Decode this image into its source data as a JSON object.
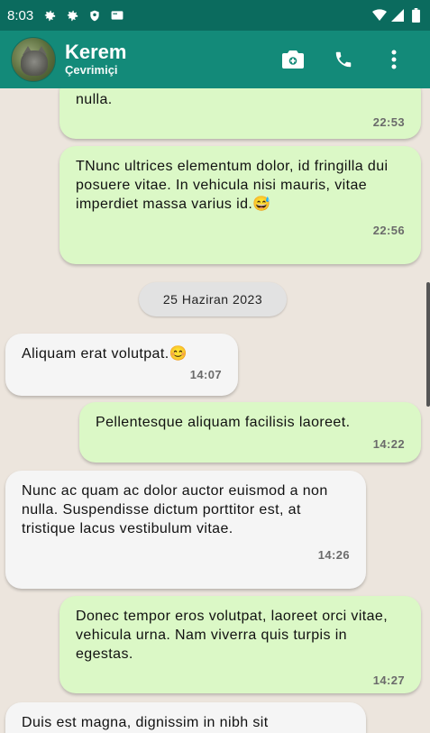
{
  "status_bar": {
    "time": "8:03",
    "left_icons": [
      "gear-icon",
      "gear-icon",
      "shield-icon",
      "card-icon"
    ],
    "right_icons": [
      "wifi-icon",
      "signal-icon",
      "battery-icon"
    ]
  },
  "header": {
    "name": "Kerem",
    "status": "Çevrimiçi",
    "actions": [
      "camera-icon",
      "phone-icon",
      "more-vert-icon"
    ]
  },
  "messages": [
    {
      "direction": "out",
      "text": "nulla.",
      "time": "22:53"
    },
    {
      "direction": "out",
      "text": "TNunc ultrices elementum dolor, id fringilla dui posuere vitae. In vehicula nisi mauris, vitae imperdiet massa varius id.😅",
      "time": "22:56"
    },
    {
      "direction": "in",
      "text": "Aliquam erat volutpat.😊",
      "time": "14:07"
    },
    {
      "direction": "out",
      "text": "Pellentesque aliquam facilisis laoreet.",
      "time": "14:22"
    },
    {
      "direction": "in",
      "text": "Nunc ac quam ac dolor auctor euismod a non nulla. Suspendisse dictum porttitor est, at tristique lacus vestibulum vitae.",
      "time": "14:26"
    },
    {
      "direction": "out",
      "text": "Donec tempor eros volutpat, laoreet orci vitae, vehicula urna. Nam viverra quis turpis in egestas.",
      "time": "14:27"
    },
    {
      "direction": "in",
      "text": "Duis est magna, dignissim in nibh sit",
      "time": ""
    }
  ],
  "date_separator": "25 Haziran 2023",
  "colors": {
    "status_bar": "#0b6b5e",
    "app_bar": "#138a79",
    "chat_bg": "#ece5dd",
    "outgoing_bubble": "#dbf8c6",
    "incoming_bubble": "#f5f5f5"
  }
}
